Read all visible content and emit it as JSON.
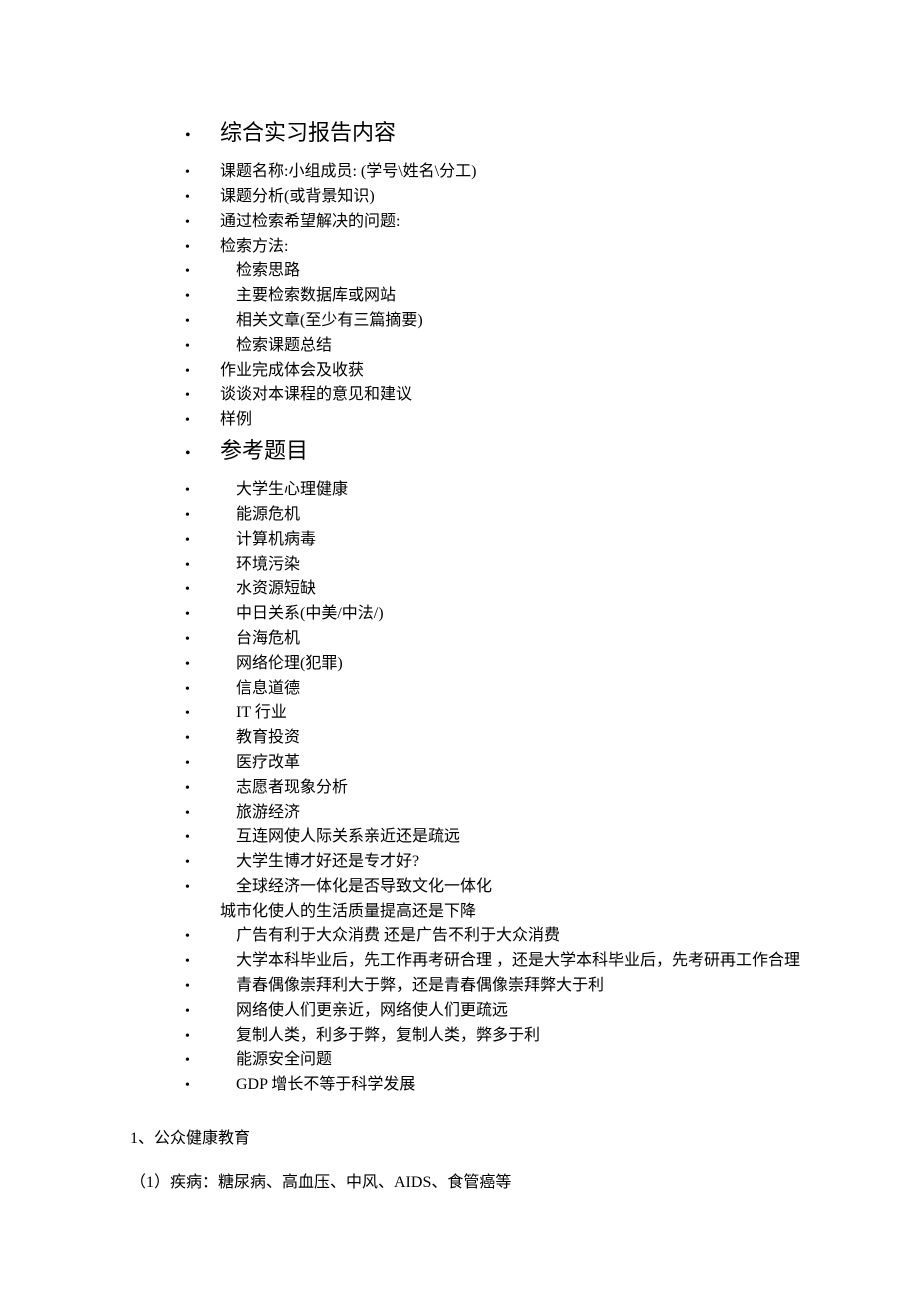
{
  "heading1": "综合实习报告内容",
  "section1_items": [
    "课题名称:小组成员: (学号\\姓名\\分工)",
    "课题分析(或背景知识)",
    "通过检索希望解决的问题:",
    "检索方法:",
    "　检索思路",
    "　主要检索数据库或网站",
    "　相关文章(至少有三篇摘要)",
    "　检索课题总结",
    "作业完成体会及收获",
    "谈谈对本课程的意见和建议",
    "样例"
  ],
  "heading2": "参考题目",
  "section2_items": [
    "　大学生心理健康",
    "　能源危机",
    "　计算机病毒",
    "　环境污染",
    "　水资源短缺",
    "　中日关系(中美/中法/)",
    "　台海危机",
    "　网络伦理(犯罪)",
    "　信息道德",
    "　IT 行业",
    "　教育投资",
    "　医疗改革",
    "　志愿者现象分析",
    "　旅游经济",
    "　互连网使人际关系亲近还是疏远",
    "　大学生博才好还是专才好?",
    "　全球经济一体化是否导致文化一体化"
  ],
  "continuation_line": "城市化使人的生活质量提高还是下降",
  "section2_items_b": [
    "　广告有利于大众消费  还是广告不利于大众消费",
    "　大学本科毕业后，先工作再考研合理  ，还是大学本科毕业后，先考研再工作合理",
    "　青春偶像崇拜利大于弊，还是青春偶像崇拜弊大于利",
    "　网络使人们更亲近，网络使人们更疏远",
    "　复制人类，利多于弊，复制人类，弊多于利",
    "　能源安全问题",
    "　GDP 增长不等于科学发展"
  ],
  "section_number": "1、公众健康教育",
  "sub_item": "（1）疾病：糖尿病、高血压、中风、AIDS、食管癌等"
}
